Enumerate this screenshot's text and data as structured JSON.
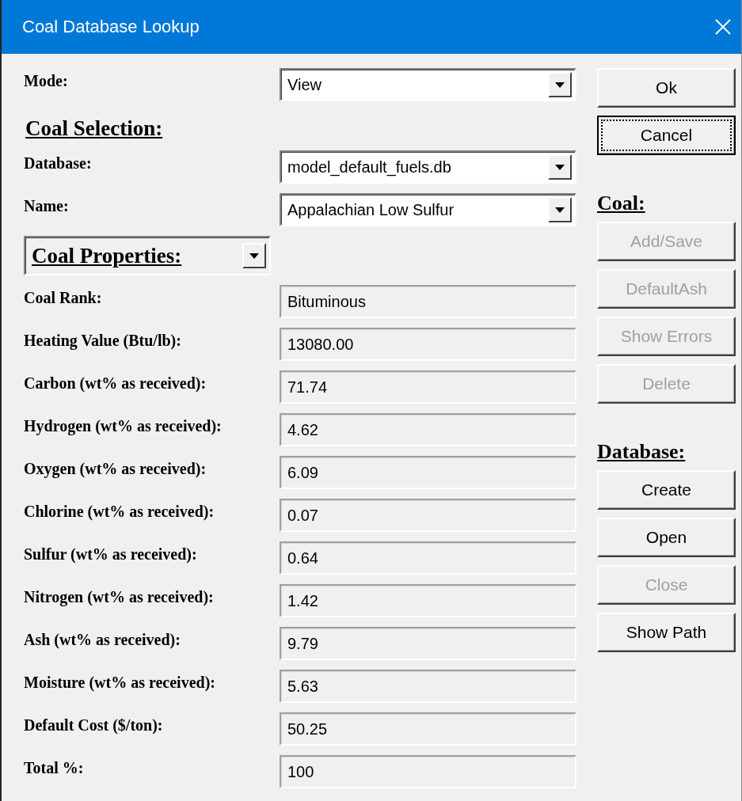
{
  "window": {
    "title": "Coal Database Lookup"
  },
  "mode": {
    "label": "Mode:",
    "value": "View"
  },
  "coal_selection": {
    "heading": "Coal Selection:",
    "fields": [
      {
        "label": "Database:",
        "value": "model_default_fuels.db"
      },
      {
        "label": "Name:",
        "value": "Appalachian Low Sulfur"
      }
    ]
  },
  "properties": {
    "selector": "Coal Properties:",
    "rows": [
      {
        "label": "Coal Rank:",
        "value": "Bituminous"
      },
      {
        "label": "Heating Value (Btu/lb):",
        "value": "13080.00"
      },
      {
        "label": "Carbon (wt% as received):",
        "value": "71.74"
      },
      {
        "label": "Hydrogen (wt% as received):",
        "value": "4.62"
      },
      {
        "label": "Oxygen (wt% as received):",
        "value": "6.09"
      },
      {
        "label": "Chlorine (wt% as received):",
        "value": "0.07"
      },
      {
        "label": "Sulfur (wt% as received):",
        "value": "0.64"
      },
      {
        "label": "Nitrogen (wt% as received):",
        "value": "1.42"
      },
      {
        "label": "Ash (wt% as received):",
        "value": "9.79"
      },
      {
        "label": "Moisture (wt% as received):",
        "value": "5.63"
      },
      {
        "label": "Default Cost ($/ton):",
        "value": "50.25"
      },
      {
        "label": "Total %:",
        "value": "100"
      }
    ]
  },
  "side_panel": [
    {
      "kind": "button",
      "label": "Ok",
      "disabled": false,
      "focused": false
    },
    {
      "kind": "button",
      "label": "Cancel",
      "disabled": false,
      "focused": true
    },
    {
      "kind": "heading",
      "label": "Coal:"
    },
    {
      "kind": "button",
      "label": "Add/Save",
      "disabled": true,
      "focused": false
    },
    {
      "kind": "button",
      "label": "DefaultAsh",
      "disabled": true,
      "focused": false
    },
    {
      "kind": "button",
      "label": "Show Errors",
      "disabled": true,
      "focused": false
    },
    {
      "kind": "button",
      "label": "Delete",
      "disabled": true,
      "focused": false
    },
    {
      "kind": "heading",
      "label": "Database:"
    },
    {
      "kind": "button",
      "label": "Create",
      "disabled": false,
      "focused": false
    },
    {
      "kind": "button",
      "label": "Open",
      "disabled": false,
      "focused": false
    },
    {
      "kind": "button",
      "label": "Close",
      "disabled": true,
      "focused": false
    },
    {
      "kind": "button",
      "label": "Show Path",
      "disabled": false,
      "focused": false
    }
  ]
}
